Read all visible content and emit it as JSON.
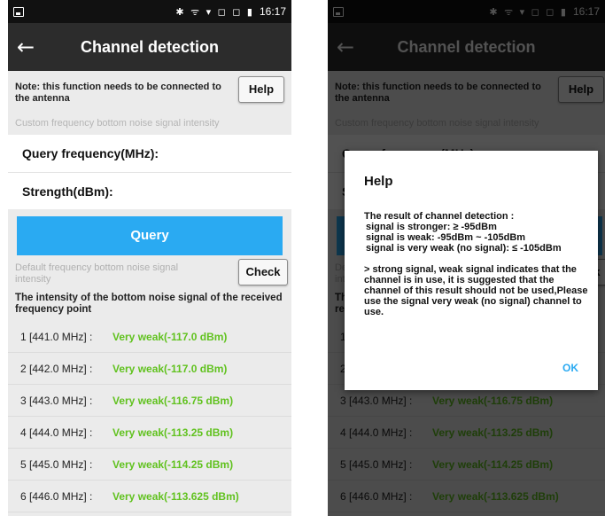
{
  "status_bar": {
    "icons": "✱ ᯤ ▾ ◻ ◻ ▮",
    "time": "16:17"
  },
  "app_bar": {
    "title": "Channel detection",
    "back_icon": "←"
  },
  "note": {
    "text": "Note: this function needs to be connected to the antenna",
    "help_label": "Help"
  },
  "custom_section": {
    "caption": "Custom frequency bottom noise signal intensity",
    "query_frequency_label": "Query frequency(MHz):",
    "strength_label": "Strength(dBm):",
    "query_button": "Query"
  },
  "default_section": {
    "caption": "Default frequency bottom noise signal intensity",
    "check_label": "Check",
    "intensity_title": "The intensity of the bottom noise signal of the received frequency point"
  },
  "results": [
    {
      "freq": "1 [441.0 MHz] :",
      "value": "Very weak(-117.0 dBm)"
    },
    {
      "freq": "2 [442.0 MHz] :",
      "value": "Very weak(-117.0 dBm)"
    },
    {
      "freq": "3 [443.0 MHz] :",
      "value": "Very weak(-116.75 dBm)"
    },
    {
      "freq": "4 [444.0 MHz] :",
      "value": "Very weak(-113.25 dBm)"
    },
    {
      "freq": "5 [445.0 MHz] :",
      "value": "Very weak(-114.25 dBm)"
    },
    {
      "freq": "6 [446.0 MHz] :",
      "value": "Very weak(-113.625 dBm)"
    }
  ],
  "dialog": {
    "title": "Help",
    "line1": "The result of channel detection :",
    "line2": "signal is stronger: ≥ -95dBm",
    "line3": "signal is weak: -95dBm ~ -105dBm",
    "line4": "signal is very weak (no signal): ≤ -105dBm",
    "paragraph": "> strong signal, weak signal indicates that the channel is in use, it is suggested that the channel of this result should not be used,Please use the signal very weak (no signal) channel to use.",
    "ok_label": "OK"
  },
  "colors": {
    "accent": "#2aaaf2",
    "value_green": "#61c21f",
    "app_bar": "#2c2c2c"
  }
}
